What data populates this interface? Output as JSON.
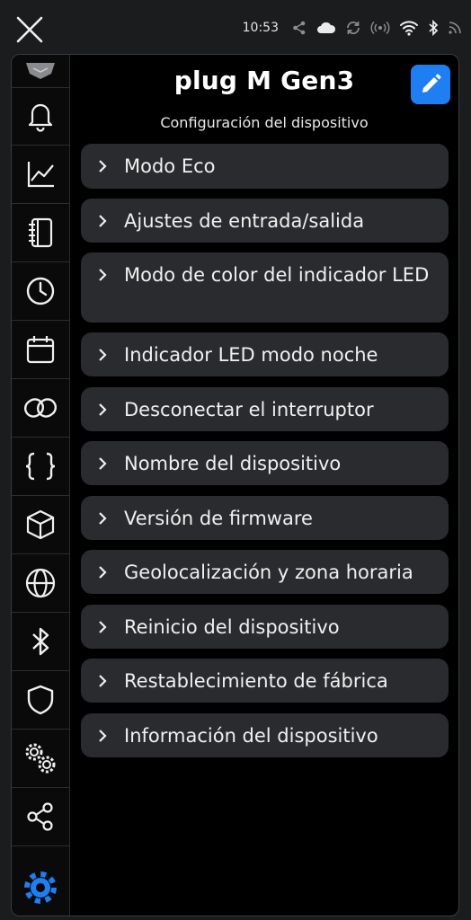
{
  "status_bar": {
    "time": "10:53",
    "icons": [
      "share-icon",
      "cloud-icon",
      "sync-icon",
      "radio-signal-icon",
      "wifi-icon",
      "bluetooth-icon",
      "rss-icon"
    ]
  },
  "header": {
    "title": "plug M Gen3",
    "subtitle": "Configuración del dispositivo",
    "edit_icon": "pencil-icon"
  },
  "sidebar": {
    "items": [
      {
        "name": "device-icon"
      },
      {
        "name": "bell-icon"
      },
      {
        "name": "chart-line-icon"
      },
      {
        "name": "notebook-icon"
      },
      {
        "name": "clock-icon"
      },
      {
        "name": "calendar-icon"
      },
      {
        "name": "link-icon"
      },
      {
        "name": "code-braces-icon"
      },
      {
        "name": "cube-icon"
      },
      {
        "name": "globe-icon"
      },
      {
        "name": "bluetooth-icon"
      },
      {
        "name": "shield-icon"
      },
      {
        "name": "gears-icon"
      },
      {
        "name": "share-icon"
      },
      {
        "name": "settings-gear-icon",
        "active": true
      }
    ]
  },
  "menu": {
    "items": [
      {
        "label": "Modo Eco"
      },
      {
        "label": "Ajustes de entrada/salida"
      },
      {
        "label": "Modo de color del indicador LED"
      },
      {
        "label": "Indicador LED modo noche"
      },
      {
        "label": "Desconectar el interruptor"
      },
      {
        "label": "Nombre del dispositivo"
      },
      {
        "label": "Versión de firmware"
      },
      {
        "label": "Geolocalización y zona horaria"
      },
      {
        "label": "Reinicio del dispositivo"
      },
      {
        "label": "Restablecimiento de fábrica"
      },
      {
        "label": "Información del dispositivo"
      }
    ]
  },
  "colors": {
    "accent": "#1f7ff2",
    "item_bg": "#2a2b2e",
    "background": "#000000"
  }
}
